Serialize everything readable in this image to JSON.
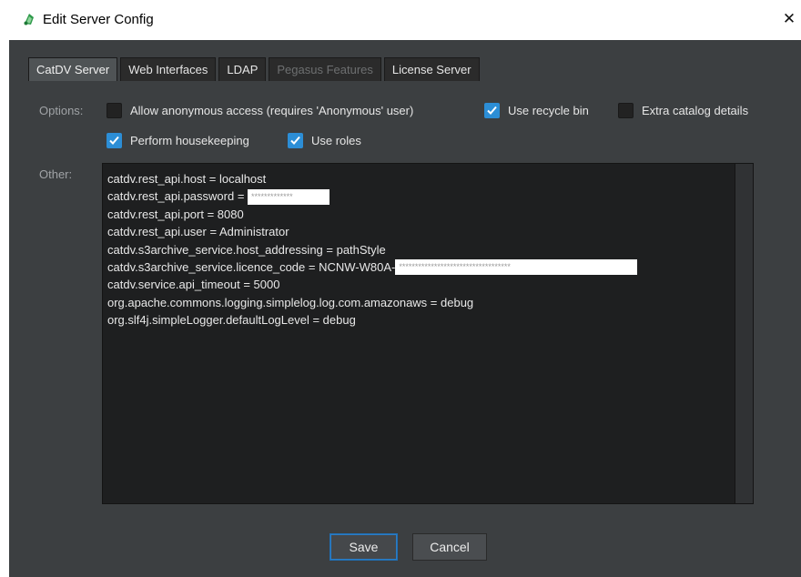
{
  "window": {
    "title": "Edit Server Config",
    "close_glyph": "✕",
    "icon": "catdv-app-icon"
  },
  "tabs": [
    {
      "label": "CatDV Server",
      "active": true,
      "enabled": true
    },
    {
      "label": "Web Interfaces",
      "active": false,
      "enabled": true
    },
    {
      "label": "LDAP",
      "active": false,
      "enabled": true
    },
    {
      "label": "Pegasus Features",
      "active": false,
      "enabled": false
    },
    {
      "label": "License Server",
      "active": false,
      "enabled": true
    }
  ],
  "options": {
    "label": "Options:",
    "items": [
      {
        "label": "Allow anonymous access (requires 'Anonymous' user)",
        "checked": false
      },
      {
        "label": "Use recycle bin",
        "checked": true
      },
      {
        "label": "Extra catalog details",
        "checked": false
      },
      {
        "label": "Perform housekeeping",
        "checked": true
      },
      {
        "label": "Use roles",
        "checked": true
      }
    ]
  },
  "other": {
    "label": "Other:",
    "lines": [
      {
        "text": "catdv.rest_api.host = localhost"
      },
      {
        "text": "catdv.rest_api.password = ",
        "redacted": "*************"
      },
      {
        "text": "catdv.rest_api.port = 8080"
      },
      {
        "text": "catdv.rest_api.user = Administrator"
      },
      {
        "text": "catdv.s3archive_service.host_addressing = pathStyle"
      },
      {
        "text": "catdv.s3archive_service.licence_code = NCNW-W80A-",
        "redacted": "***********************************"
      },
      {
        "text": "catdv.service.api_timeout = 5000"
      },
      {
        "text": "org.apache.commons.logging.simplelog.log.com.amazonaws = debug"
      },
      {
        "text": "org.slf4j.simpleLogger.defaultLogLevel = debug"
      }
    ]
  },
  "buttons": {
    "save": "Save",
    "cancel": "Cancel"
  },
  "colors": {
    "dialog_bg": "#3c3f41",
    "checkbox_checked": "#2c8ed6",
    "text_area_bg": "#1e1f20",
    "default_button_border": "#1f6fb5"
  }
}
